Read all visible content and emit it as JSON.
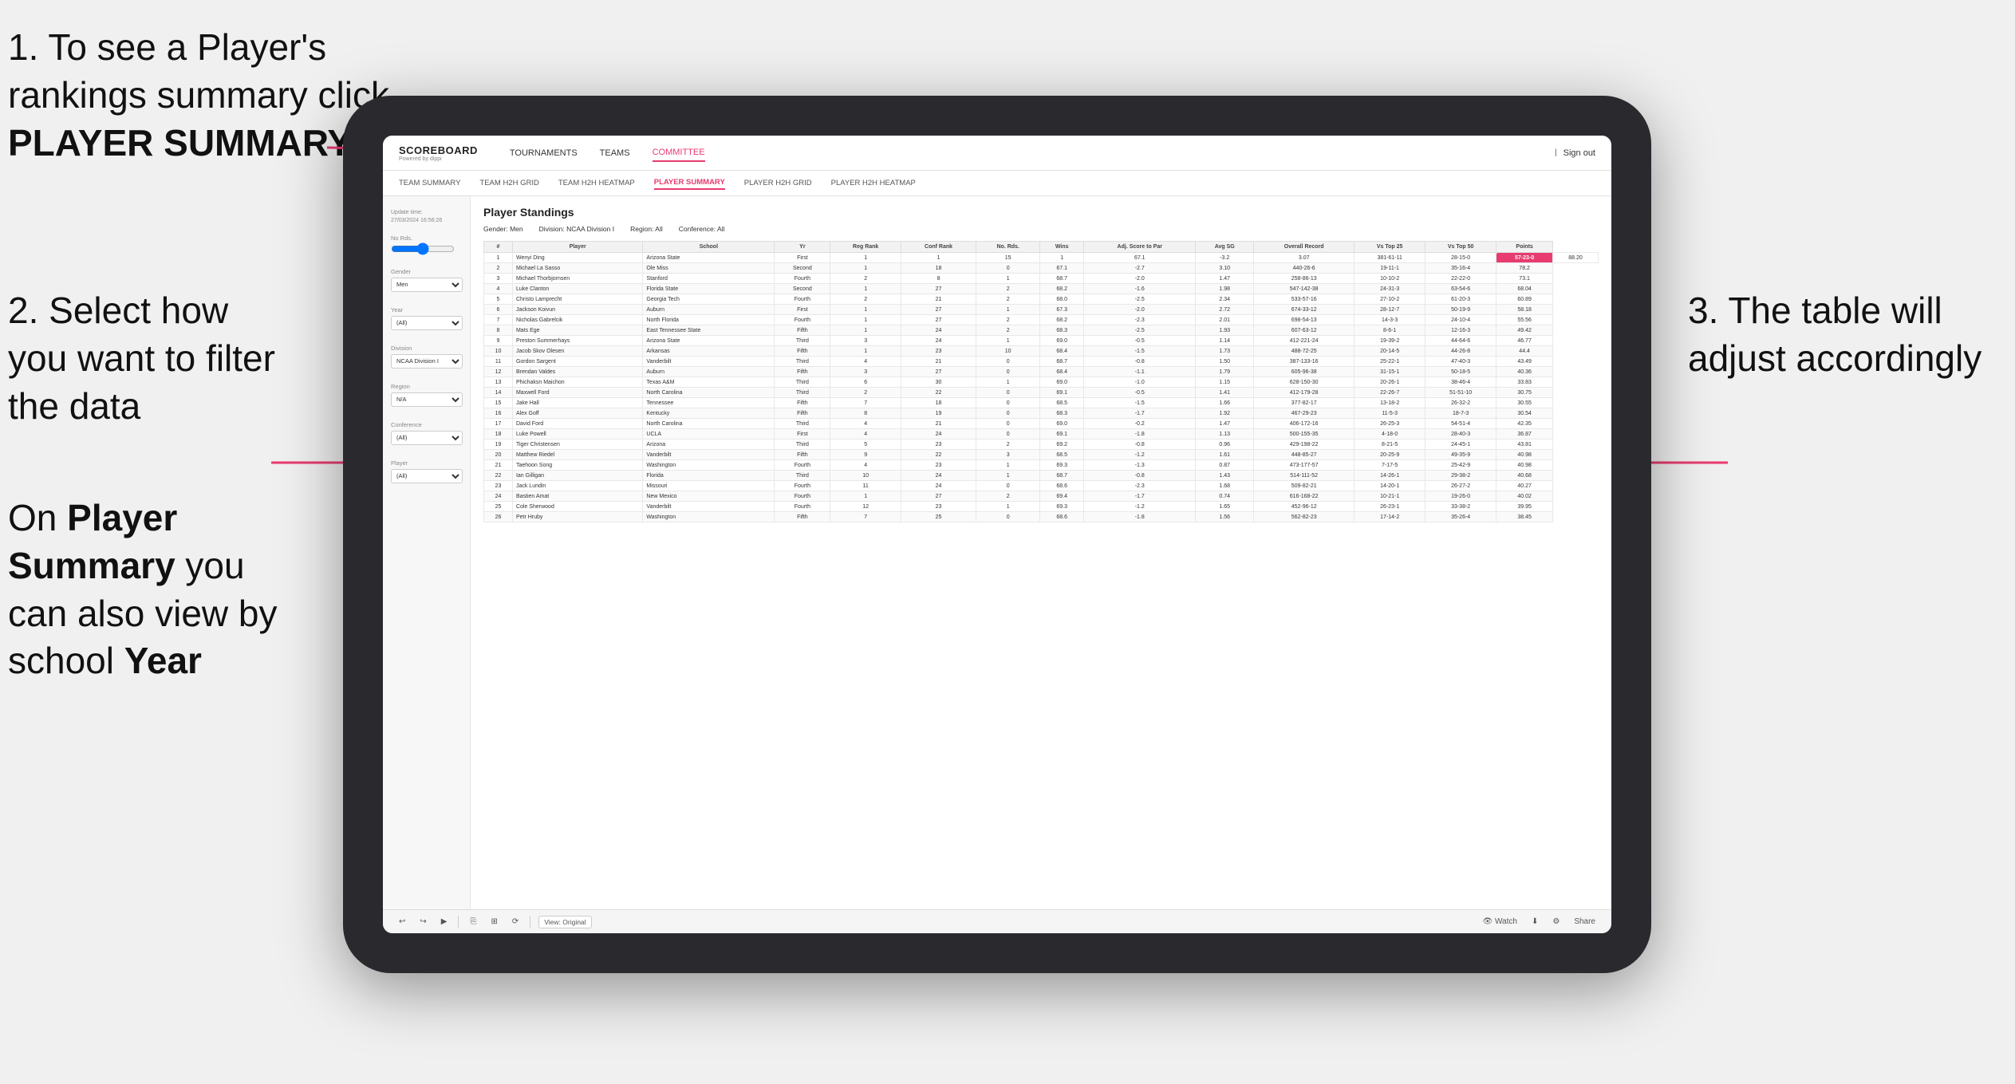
{
  "instructions": {
    "step1": "1. To see a Player's rankings summary click ",
    "step1_bold": "PLAYER SUMMARY",
    "step2_title": "2. Select how you want to filter the data",
    "step3": "3. The table will adjust accordingly",
    "bottom_note1": "On ",
    "bottom_bold1": "Player Summary",
    "bottom_note2": " you can also view by school ",
    "bottom_bold2": "Year"
  },
  "nav": {
    "logo": "SCOREBOARD",
    "logo_sub": "Powered by dippi",
    "items": [
      "TOURNAMENTS",
      "TEAMS",
      "COMMITTEE"
    ],
    "active": "COMMITTEE",
    "sign_out": "Sign out"
  },
  "sub_nav": {
    "items": [
      "TEAM SUMMARY",
      "TEAM H2H GRID",
      "TEAM H2H HEATMAP",
      "PLAYER SUMMARY",
      "PLAYER H2H GRID",
      "PLAYER H2H HEATMAP"
    ],
    "active": "PLAYER SUMMARY"
  },
  "sidebar": {
    "update_label": "Update time:",
    "update_time": "27/03/2024 16:56:26",
    "no_rds_label": "No Rds.",
    "gender_label": "Gender",
    "gender_value": "Men",
    "year_label": "Year",
    "year_value": "(All)",
    "division_label": "Division",
    "division_value": "NCAA Division I",
    "region_label": "Region",
    "region_value": "N/A",
    "conference_label": "Conference",
    "conference_value": "(All)",
    "player_label": "Player",
    "player_value": "(All)"
  },
  "table": {
    "title": "Player Standings",
    "filters": {
      "gender": "Gender: Men",
      "division": "Division: NCAA Division I",
      "region": "Region: All",
      "conference": "Conference: All"
    },
    "columns": [
      "#",
      "Player",
      "School",
      "Yr",
      "Reg Rank",
      "Conf Rank",
      "No. Rds.",
      "Wins",
      "Adj. Score to Par",
      "Avg SG",
      "Overall Record",
      "Vs Top 25",
      "Vs Top 50",
      "Points"
    ],
    "rows": [
      [
        "1",
        "Wenyi Ding",
        "Arizona State",
        "First",
        "1",
        "1",
        "15",
        "1",
        "67.1",
        "-3.2",
        "3.07",
        "381-61-11",
        "28-15-0",
        "57-23-0",
        "88.20"
      ],
      [
        "2",
        "Michael La Sasso",
        "Ole Miss",
        "Second",
        "1",
        "18",
        "0",
        "67.1",
        "-2.7",
        "3.10",
        "440-26-6",
        "19-11-1",
        "35-16-4",
        "78.2"
      ],
      [
        "3",
        "Michael Thorbjornsen",
        "Stanford",
        "Fourth",
        "2",
        "8",
        "1",
        "68.7",
        "-2.0",
        "1.47",
        "258-86-13",
        "10-10-2",
        "22-22-0",
        "73.1"
      ],
      [
        "4",
        "Luke Clanton",
        "Florida State",
        "Second",
        "1",
        "27",
        "2",
        "68.2",
        "-1.6",
        "1.98",
        "547-142-38",
        "24-31-3",
        "63-54-6",
        "68.04"
      ],
      [
        "5",
        "Christo Lamprecht",
        "Georgia Tech",
        "Fourth",
        "2",
        "21",
        "2",
        "68.0",
        "-2.5",
        "2.34",
        "533-57-16",
        "27-10-2",
        "61-20-3",
        "60.89"
      ],
      [
        "6",
        "Jackson Koivun",
        "Auburn",
        "First",
        "1",
        "27",
        "1",
        "67.3",
        "-2.0",
        "2.72",
        "674-33-12",
        "28-12-7",
        "50-19-9",
        "58.18"
      ],
      [
        "7",
        "Nicholas Gabrelcik",
        "North Florida",
        "Fourth",
        "1",
        "27",
        "2",
        "68.2",
        "-2.3",
        "2.01",
        "698-54-13",
        "14-3-3",
        "24-10-4",
        "55.56"
      ],
      [
        "8",
        "Mats Ege",
        "East Tennessee State",
        "Fifth",
        "1",
        "24",
        "2",
        "68.3",
        "-2.5",
        "1.93",
        "607-63-12",
        "8-6-1",
        "12-16-3",
        "49.42"
      ],
      [
        "9",
        "Preston Summerhays",
        "Arizona State",
        "Third",
        "3",
        "24",
        "1",
        "69.0",
        "-0.5",
        "1.14",
        "412-221-24",
        "19-39-2",
        "44-64-6",
        "46.77"
      ],
      [
        "10",
        "Jacob Skov Olesen",
        "Arkansas",
        "Fifth",
        "1",
        "23",
        "10",
        "68.4",
        "-1.5",
        "1.73",
        "488-72-25",
        "20-14-5",
        "44-26-8",
        "44.4"
      ],
      [
        "11",
        "Gordon Sargent",
        "Vanderbilt",
        "Third",
        "4",
        "21",
        "0",
        "68.7",
        "-0.8",
        "1.50",
        "387-133-16",
        "25-22-1",
        "47-40-3",
        "43.49"
      ],
      [
        "12",
        "Brendan Valdes",
        "Auburn",
        "Fifth",
        "3",
        "27",
        "0",
        "68.4",
        "-1.1",
        "1.79",
        "605-96-38",
        "31-15-1",
        "50-18-5",
        "40.36"
      ],
      [
        "13",
        "Phichaksn Maichon",
        "Texas A&M",
        "Third",
        "6",
        "30",
        "1",
        "69.0",
        "-1.0",
        "1.15",
        "628-150-30",
        "20-26-1",
        "38-46-4",
        "33.83"
      ],
      [
        "14",
        "Maxwell Ford",
        "North Carolina",
        "Third",
        "2",
        "22",
        "0",
        "69.1",
        "-0.5",
        "1.41",
        "412-179-28",
        "22-26-7",
        "51-51-10",
        "30.75"
      ],
      [
        "15",
        "Jake Hall",
        "Tennessee",
        "Fifth",
        "7",
        "18",
        "0",
        "68.5",
        "-1.5",
        "1.66",
        "377-82-17",
        "13-18-2",
        "26-32-2",
        "30.55"
      ],
      [
        "16",
        "Alex Goff",
        "Kentucky",
        "Fifth",
        "8",
        "19",
        "0",
        "68.3",
        "-1.7",
        "1.92",
        "467-29-23",
        "11-5-3",
        "18-7-3",
        "30.54"
      ],
      [
        "17",
        "David Ford",
        "North Carolina",
        "Third",
        "4",
        "21",
        "0",
        "69.0",
        "-0.2",
        "1.47",
        "406-172-16",
        "26-25-3",
        "54-51-4",
        "42.35"
      ],
      [
        "18",
        "Luke Powell",
        "UCLA",
        "First",
        "4",
        "24",
        "0",
        "69.1",
        "-1.8",
        "1.13",
        "500-155-35",
        "4-18-0",
        "28-40-3",
        "36.87"
      ],
      [
        "19",
        "Tiger Christensen",
        "Arizona",
        "Third",
        "5",
        "23",
        "2",
        "69.2",
        "-0.8",
        "0.96",
        "429-198-22",
        "8-21-5",
        "24-45-1",
        "43.81"
      ],
      [
        "20",
        "Matthew Riedel",
        "Vanderbilt",
        "Fifth",
        "9",
        "22",
        "3",
        "68.5",
        "-1.2",
        "1.61",
        "448-85-27",
        "20-25-9",
        "49-35-9",
        "40.98"
      ],
      [
        "21",
        "Taehoon Song",
        "Washington",
        "Fourth",
        "4",
        "23",
        "1",
        "69.3",
        "-1.3",
        "0.87",
        "473-177-57",
        "7-17-5",
        "25-42-9",
        "40.98"
      ],
      [
        "22",
        "Ian Gilligan",
        "Florida",
        "Third",
        "10",
        "24",
        "1",
        "68.7",
        "-0.8",
        "1.43",
        "514-111-52",
        "14-26-1",
        "29-38-2",
        "40.68"
      ],
      [
        "23",
        "Jack Lundin",
        "Missouri",
        "Fourth",
        "11",
        "24",
        "0",
        "68.6",
        "-2.3",
        "1.68",
        "509-82-21",
        "14-20-1",
        "26-27-2",
        "40.27"
      ],
      [
        "24",
        "Bastien Amat",
        "New Mexico",
        "Fourth",
        "1",
        "27",
        "2",
        "69.4",
        "-1.7",
        "0.74",
        "616-168-22",
        "10-21-1",
        "19-26-0",
        "40.02"
      ],
      [
        "25",
        "Cole Sherwood",
        "Vanderbilt",
        "Fourth",
        "12",
        "23",
        "1",
        "69.3",
        "-1.2",
        "1.65",
        "452-96-12",
        "26-23-1",
        "33-38-2",
        "39.95"
      ],
      [
        "26",
        "Petr Hruby",
        "Washington",
        "Fifth",
        "7",
        "25",
        "0",
        "68.6",
        "-1.8",
        "1.56",
        "562-82-23",
        "17-14-2",
        "35-26-4",
        "38.45"
      ]
    ]
  },
  "toolbar": {
    "view_label": "View: Original",
    "watch_label": "Watch",
    "share_label": "Share"
  }
}
